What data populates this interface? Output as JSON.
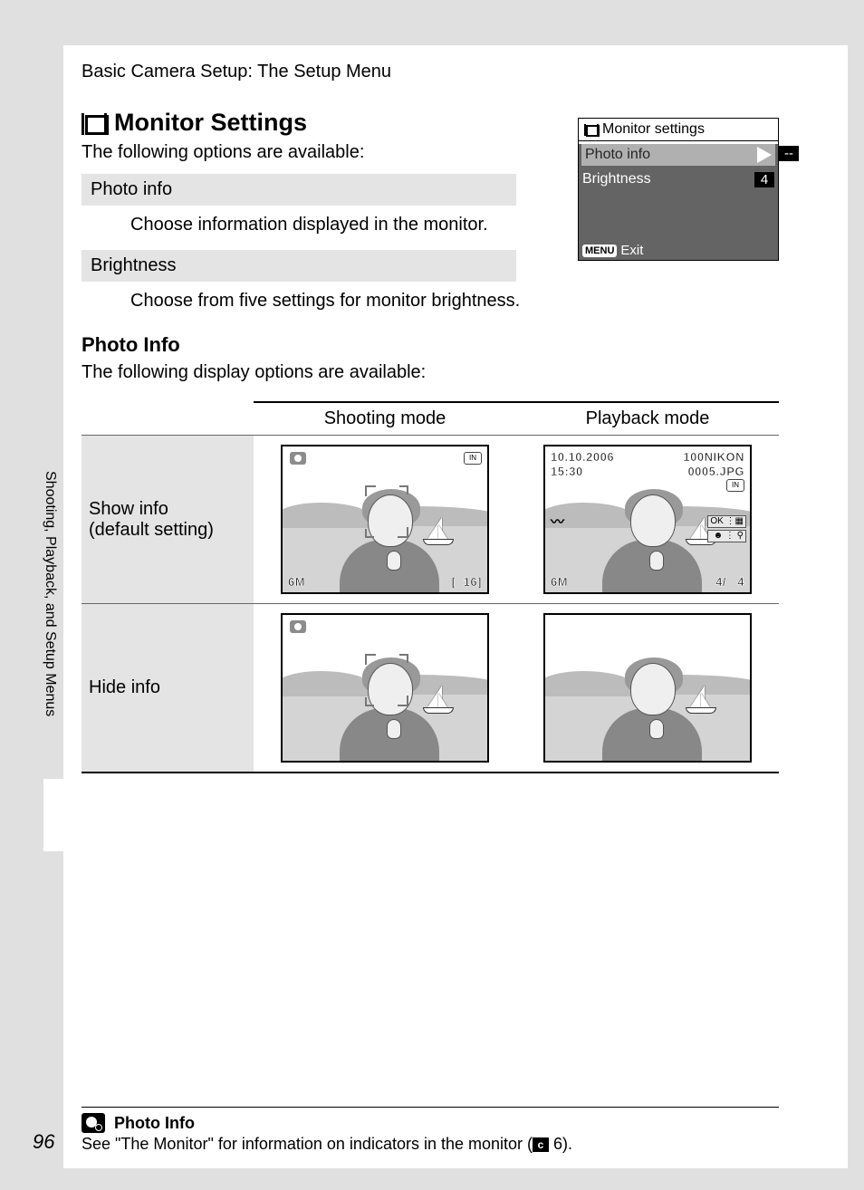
{
  "header": "Basic Camera Setup: The Setup Menu",
  "side_label": "Shooting, Playback, and Setup Menus",
  "title": "Monitor Settings",
  "intro": "The following options are available:",
  "options": {
    "photo_info": {
      "name": "Photo info",
      "desc": "Choose information displayed in the monitor."
    },
    "brightness": {
      "name": "Brightness",
      "desc": "Choose from five settings for monitor brightness."
    }
  },
  "menu": {
    "title": "Monitor settings",
    "row1": "Photo info",
    "row1_val": "--",
    "row2": "Brightness",
    "row2_val": "4",
    "footer_btn": "MENU",
    "footer_txt": "Exit"
  },
  "section2": {
    "title": "Photo Info",
    "intro": "The following display options are available:"
  },
  "table": {
    "col1": "Shooting mode",
    "col2": "Playback mode",
    "row1_label_a": "Show info",
    "row1_label_b": "(default setting)",
    "row2_label": "Hide info"
  },
  "overlay": {
    "shoot_6m": "6M",
    "shoot_count_open": "[",
    "shoot_count": "16",
    "shoot_count_close": "]",
    "in_label": "IN",
    "pb_date": "10.10.2006",
    "pb_time": "15:30",
    "pb_folder": "100NIKON",
    "pb_file": "0005.JPG",
    "pb_ok": "OK",
    "pb_4a": "4/",
    "pb_4b": "4",
    "pb_6m": "6M"
  },
  "footer": {
    "title": "Photo Info",
    "body_a": "See \"The Monitor\" for information on indicators in the monitor (",
    "body_b": " 6).",
    "ref_icon": "c"
  },
  "page_num": "96"
}
